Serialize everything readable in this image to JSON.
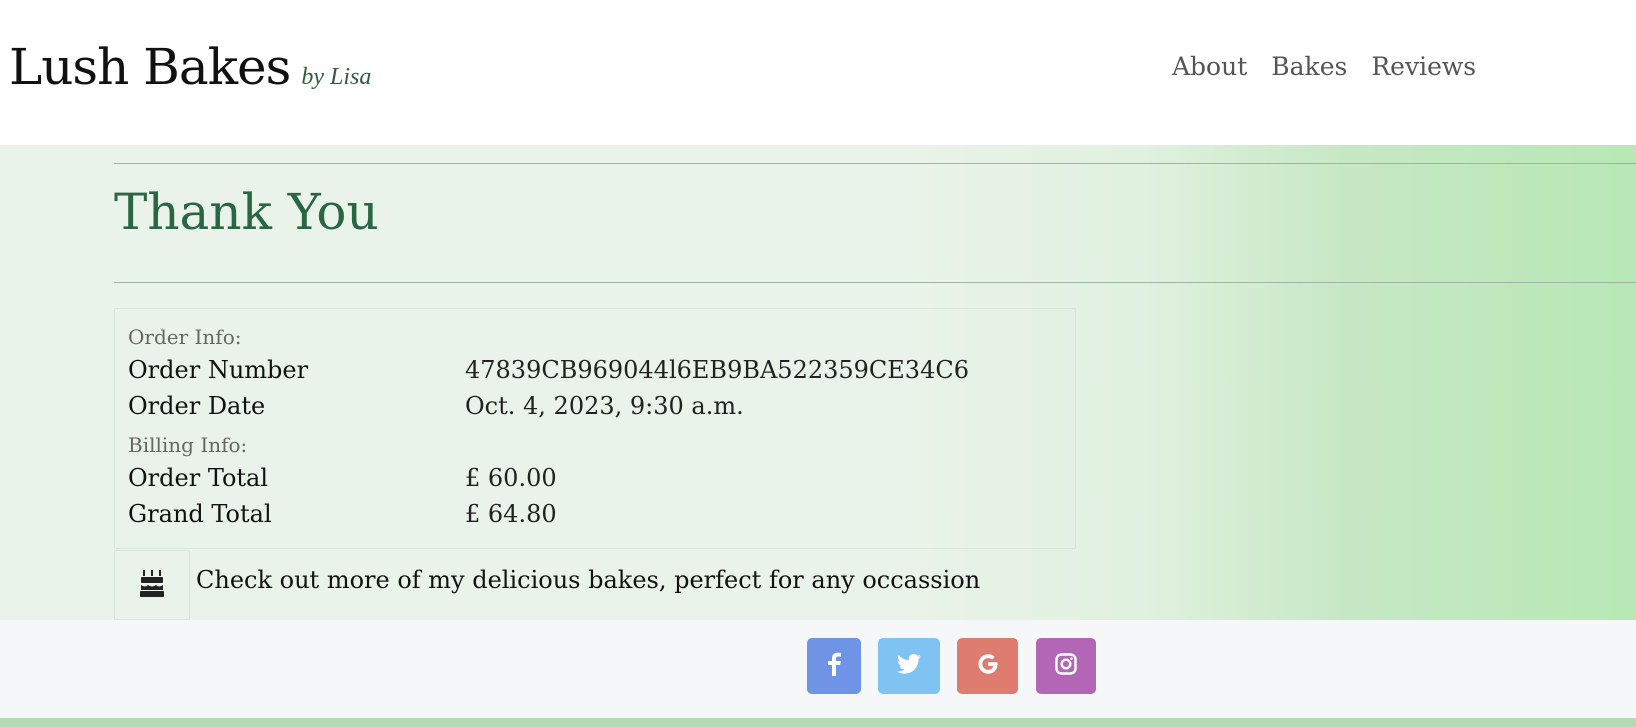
{
  "brand": {
    "name": "Lush Bakes",
    "tagline": "by Lisa"
  },
  "nav": {
    "items": [
      "About",
      "Bakes",
      "Reviews"
    ]
  },
  "page": {
    "title": "Thank You"
  },
  "order_info": {
    "heading": "Order Info:",
    "order_number_label": "Order Number",
    "order_number": "47839CB969044l6EB9BA522359CE34C6",
    "order_date_label": "Order Date",
    "order_date": "Oct. 4, 2023, 9:30 a.m."
  },
  "billing_info": {
    "heading": "Billing Info:",
    "order_total_label": "Order Total",
    "order_total": "£ 60.00",
    "grand_total_label": "Grand Total",
    "grand_total": "£ 64.80"
  },
  "cta": {
    "icon": "cake-icon",
    "text": "Check out more of my delicious bakes, perfect for any occassion"
  },
  "footer": {
    "social": [
      {
        "name": "facebook-icon",
        "color": "#6f94e6"
      },
      {
        "name": "twitter-icon",
        "color": "#7fc3f3"
      },
      {
        "name": "google-icon",
        "color": "#de7c70"
      },
      {
        "name": "instagram-icon",
        "color": "#b366b5"
      }
    ]
  },
  "colors": {
    "title": "#2a6644",
    "gradient_end": "#b8e8b6",
    "footer_bar": "#b5d9b3"
  }
}
